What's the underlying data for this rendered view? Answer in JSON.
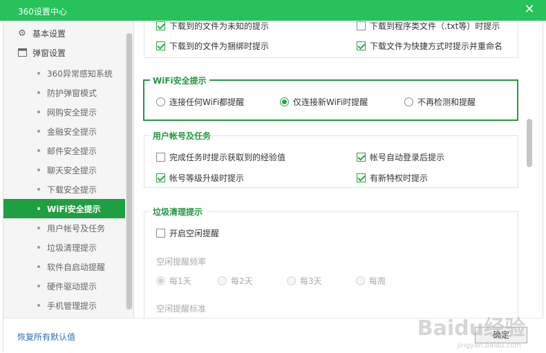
{
  "window": {
    "title": "360设置中心"
  },
  "sidebar": {
    "groups": [
      {
        "label": "基本设置",
        "icon": "gear-icon"
      },
      {
        "label": "弹窗设置",
        "icon": "window-icon"
      }
    ],
    "items": [
      {
        "label": "360异常感知系统"
      },
      {
        "label": "防护弹窗模式"
      },
      {
        "label": "网购安全提示"
      },
      {
        "label": "金融安全提示"
      },
      {
        "label": "邮件安全提示"
      },
      {
        "label": "聊天安全提示"
      },
      {
        "label": "下载安全提示"
      },
      {
        "label": "WiFi安全提示"
      },
      {
        "label": "用户帐号及任务"
      },
      {
        "label": "垃圾清理提示"
      },
      {
        "label": "软件自启动提醒"
      },
      {
        "label": "硬件驱动提示"
      },
      {
        "label": "手机管理提示"
      }
    ],
    "active_index": 7
  },
  "download": {
    "partial_left": "下载到的文件为未知的提示",
    "partial_right": "下载到程序类文件（.txt等）时提示",
    "opt_bundled": "下载到的文件为捆绑时提示",
    "opt_shortcut": "下载文件为快捷方式时提示并重命名"
  },
  "wifi": {
    "title": "WiFi安全提示",
    "opt_any": "连接任何WiFi都提醒",
    "opt_new": "仅连接新WiFi时提醒",
    "opt_never": "不再检测和提醒",
    "selected": "opt_new"
  },
  "account": {
    "title": "用户帐号及任务",
    "opt_task_exp": "完成任务时提示获取到的经验值",
    "opt_auto_login": "帐号自动登录后提示",
    "opt_level_up": "帐号等级升级时提示",
    "opt_new_priv": "有新特权时提示"
  },
  "cleanup": {
    "title": "垃圾清理提示",
    "opt_idle": "开启空闲提醒",
    "freq_label": "空闲提醒频率",
    "freq_daily": "每1天",
    "freq_2day": "每2天",
    "freq_3day": "每3天",
    "freq_weekly": "每周",
    "std_label": "空闲提醒标准"
  },
  "footer": {
    "reset_label": "恢复所有默认值",
    "ok_label": "确定"
  },
  "watermark": {
    "main": "Baidu经验",
    "sub": "jingyan.baidu.com"
  },
  "colors": {
    "accent": "#27c25a",
    "active_item": "#1e9f43",
    "link": "#2d6fbf"
  }
}
